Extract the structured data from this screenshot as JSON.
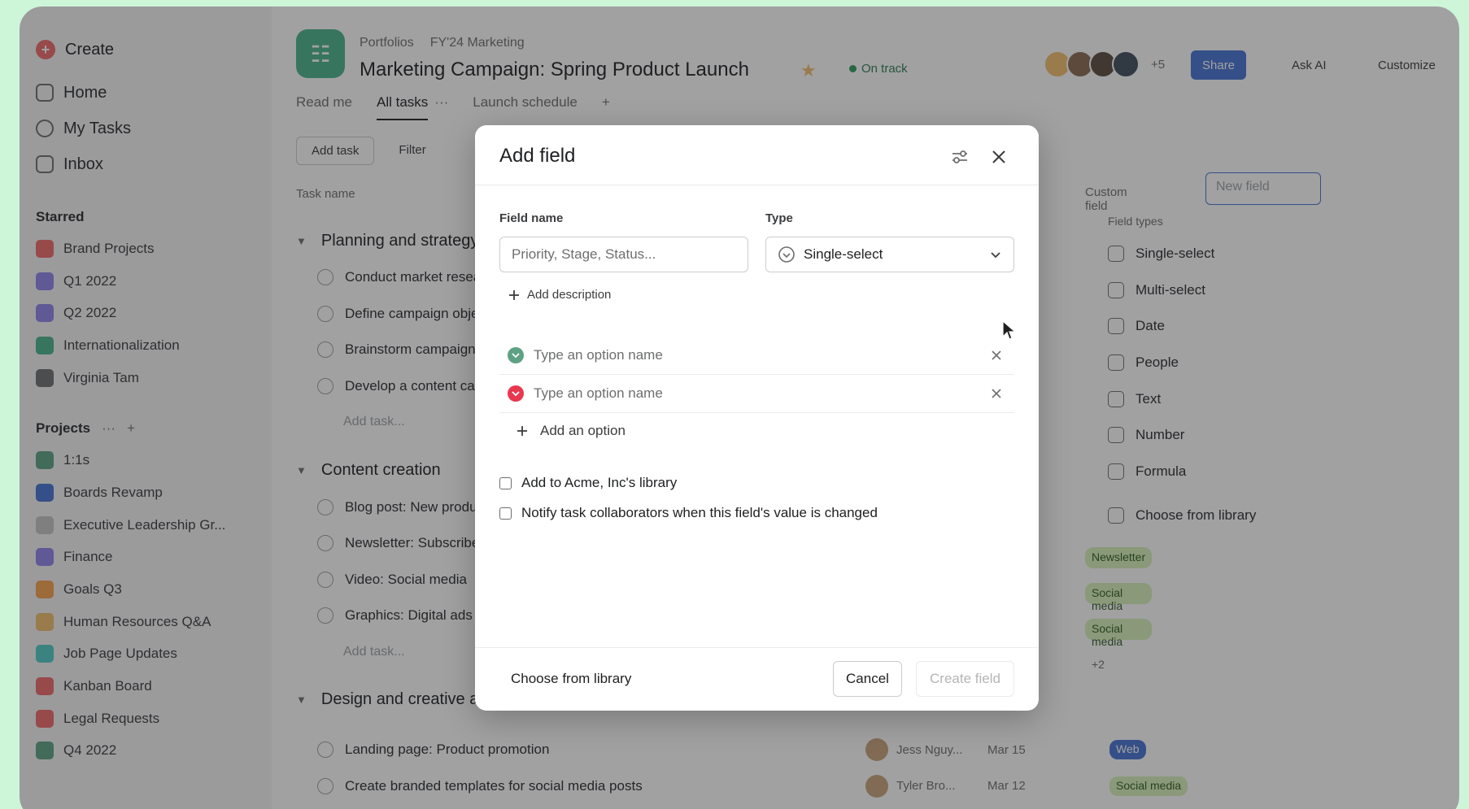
{
  "sidebar": {
    "create_label": "Create",
    "nav": [
      {
        "label": "Home",
        "icon": "home-icon"
      },
      {
        "label": "My Tasks",
        "icon": "check-circle-icon"
      },
      {
        "label": "Inbox",
        "icon": "bell-icon"
      }
    ],
    "starred_title": "Starred",
    "starred": [
      {
        "label": "Brand Projects",
        "color": "#f06a6a"
      },
      {
        "label": "Q1 2022",
        "color": "#8d84e8"
      },
      {
        "label": "Q2 2022",
        "color": "#8d84e8"
      },
      {
        "label": "Internationalization",
        "color": "#4bb38a"
      },
      {
        "label": "Virginia Tam",
        "color": "#6d6e6f"
      }
    ],
    "projects_title": "Projects",
    "projects_more": "···",
    "projects_add": "+",
    "projects": [
      {
        "label": "1:1s",
        "color": "#5da283"
      },
      {
        "label": "Boards Revamp",
        "color": "#4573d2"
      },
      {
        "label": "Executive Leadership Gr...",
        "color": "#c7c4c4"
      },
      {
        "label": "Finance",
        "color": "#8d84e8"
      },
      {
        "label": "Goals Q3",
        "color": "#f8a04a"
      },
      {
        "label": "Human Resources Q&A",
        "color": "#f1bd6c"
      },
      {
        "label": "Job Page Updates",
        "color": "#4ecbc4"
      },
      {
        "label": "Kanban Board",
        "color": "#f06a6a"
      },
      {
        "label": "Legal Requests",
        "color": "#f06a6a"
      },
      {
        "label": "Q4 2022",
        "color": "#5da283"
      }
    ]
  },
  "header": {
    "breadcrumb": [
      "Portfolios",
      "FY'24 Marketing"
    ],
    "title": "Marketing Campaign: Spring Product Launch",
    "status": "On track",
    "avatar_more": "+5",
    "share_label": "Share",
    "askai_label": "Ask AI",
    "customize_label": "Customize"
  },
  "tabs": [
    {
      "label": "Read me"
    },
    {
      "label": "All tasks",
      "active": true
    },
    {
      "label": "···"
    },
    {
      "label": "Launch schedule"
    },
    {
      "label": "+"
    }
  ],
  "toolbar": {
    "add_task": "Add task",
    "filter": "Filter"
  },
  "columns": {
    "task_name": "Task name",
    "custom_label": "Custom field",
    "new_field_placeholder": "New field"
  },
  "groups": [
    {
      "title": "Planning and strategy",
      "tasks": [
        "Conduct market research",
        "Define campaign objectives",
        "Brainstorm campaign ideas",
        "Develop a content calendar"
      ],
      "add_task": "Add task..."
    },
    {
      "title": "Content creation",
      "tasks": [
        "Blog post: New product",
        "Newsletter: Subscriber",
        "Video: Social media",
        "Graphics: Digital ads"
      ],
      "add_task": "Add task..."
    },
    {
      "title": "Design and creative asset production",
      "tasks": [],
      "add_task": ""
    }
  ],
  "bottom_rows": [
    {
      "task": "Landing page: Product promotion",
      "assignee": "Jess Nguy...",
      "date": "Mar 15",
      "tag": "Web",
      "tag_color": "#4573d2",
      "tag_text": "#ffffff"
    },
    {
      "task": "Create branded templates for social media posts",
      "assignee": "Tyler Bro...",
      "date": "Mar 12",
      "tag": "Social media",
      "tag_color": "#d7f2b8",
      "tag_text": "#2e5c1e"
    }
  ],
  "field_types": {
    "title": "Field types",
    "items": [
      {
        "label": "Single-select",
        "icon": "single-select-icon"
      },
      {
        "label": "Multi-select",
        "icon": "multi-select-icon"
      },
      {
        "label": "Date",
        "icon": "calendar-icon"
      },
      {
        "label": "People",
        "icon": "person-icon"
      },
      {
        "label": "Text",
        "icon": "text-icon"
      },
      {
        "label": "Number",
        "icon": "number-icon"
      },
      {
        "label": "Formula",
        "icon": "formula-icon"
      },
      {
        "label": "Choose from library",
        "icon": "library-icon"
      }
    ]
  },
  "tags": [
    {
      "label": "Newsletter",
      "color": "#d7f2b8"
    },
    {
      "label": "Social media",
      "color": "#d7f2b8"
    },
    {
      "label": "Social media",
      "color": "#d7f2b8"
    }
  ],
  "tag_more": "+2",
  "modal": {
    "title": "Add field",
    "field_name_label": "Field name",
    "field_name_placeholder": "Priority, Stage, Status...",
    "field_name_value": "",
    "type_label": "Type",
    "type_value": "Single-select",
    "add_description": "Add description",
    "options": [
      {
        "placeholder": "Type an option name",
        "color": "#5da283",
        "value": ""
      },
      {
        "placeholder": "Type an option name",
        "color": "#e8384f",
        "value": ""
      }
    ],
    "add_option": "Add an option",
    "checkbox_library": "Add to Acme, Inc's library",
    "checkbox_notify": "Notify task collaborators when this field's value is changed",
    "choose_from_library": "Choose from library",
    "cancel": "Cancel",
    "create": "Create field"
  }
}
